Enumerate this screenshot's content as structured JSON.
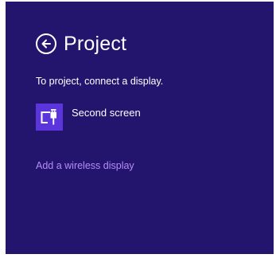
{
  "panel": {
    "title": "Project",
    "subtitle": "To project, connect a display.",
    "back_icon": "back-arrow-circle-icon",
    "options": [
      {
        "label": "Second screen",
        "icon": "second-screen-icon"
      }
    ],
    "wireless_link": "Add a wireless display"
  },
  "colors": {
    "panel_background": "#23146e",
    "tile_accent": "#5b34dc",
    "link_color": "#b58cf8",
    "text": "#ffffff"
  }
}
